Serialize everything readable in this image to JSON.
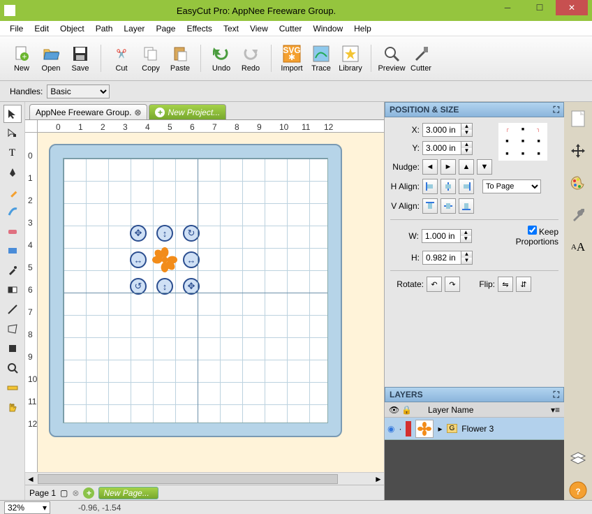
{
  "window": {
    "title": "EasyCut Pro: AppNee Freeware Group."
  },
  "menu": [
    "File",
    "Edit",
    "Object",
    "Path",
    "Layer",
    "Page",
    "Effects",
    "Text",
    "View",
    "Cutter",
    "Window",
    "Help"
  ],
  "toolbar": {
    "new": "New",
    "open": "Open",
    "save": "Save",
    "cut": "Cut",
    "copy": "Copy",
    "paste": "Paste",
    "undo": "Undo",
    "redo": "Redo",
    "import": "Import",
    "trace": "Trace",
    "library": "Library",
    "preview": "Preview",
    "cutter": "Cutter"
  },
  "handles": {
    "label": "Handles:",
    "value": "Basic"
  },
  "tabs": [
    {
      "label": "AppNee Freeware Group.",
      "closable": true,
      "new": false
    },
    {
      "label": "New Project...",
      "closable": false,
      "new": true
    }
  ],
  "ruler_ticks_h": [
    "0",
    "1",
    "2",
    "3",
    "4",
    "5",
    "6",
    "7",
    "8",
    "9",
    "10",
    "11",
    "12"
  ],
  "ruler_ticks_v": [
    "0",
    "1",
    "2",
    "3",
    "4",
    "5",
    "6",
    "7",
    "8",
    "9",
    "10",
    "11",
    "12"
  ],
  "position_size": {
    "title": "POSITION & SIZE",
    "x_label": "X:",
    "x_value": "3.000 in",
    "y_label": "Y:",
    "y_value": "3.000 in",
    "nudge_label": "Nudge:",
    "halign_label": "H Align:",
    "valign_label": "V Align:",
    "align_to": "To Page",
    "w_label": "W:",
    "w_value": "1.000 in",
    "h_label": "H:",
    "h_value": "0.982 in",
    "keep_prop": "Keep Proportions",
    "rotate_label": "Rotate:",
    "flip_label": "Flip:"
  },
  "layers": {
    "title": "LAYERS",
    "header": "Layer Name",
    "items": [
      {
        "name": "Flower 3",
        "group_tag": "G",
        "visible": true,
        "color": "#d32f2f"
      }
    ]
  },
  "pagebar": {
    "page_label": "Page 1",
    "new_page": "New Page..."
  },
  "status": {
    "zoom": "32%",
    "coords": "-0.96, -1.54"
  },
  "colors": {
    "accent": "#95c53e",
    "panel_header": "#9ec7e6",
    "flower": "#f28c1a"
  }
}
